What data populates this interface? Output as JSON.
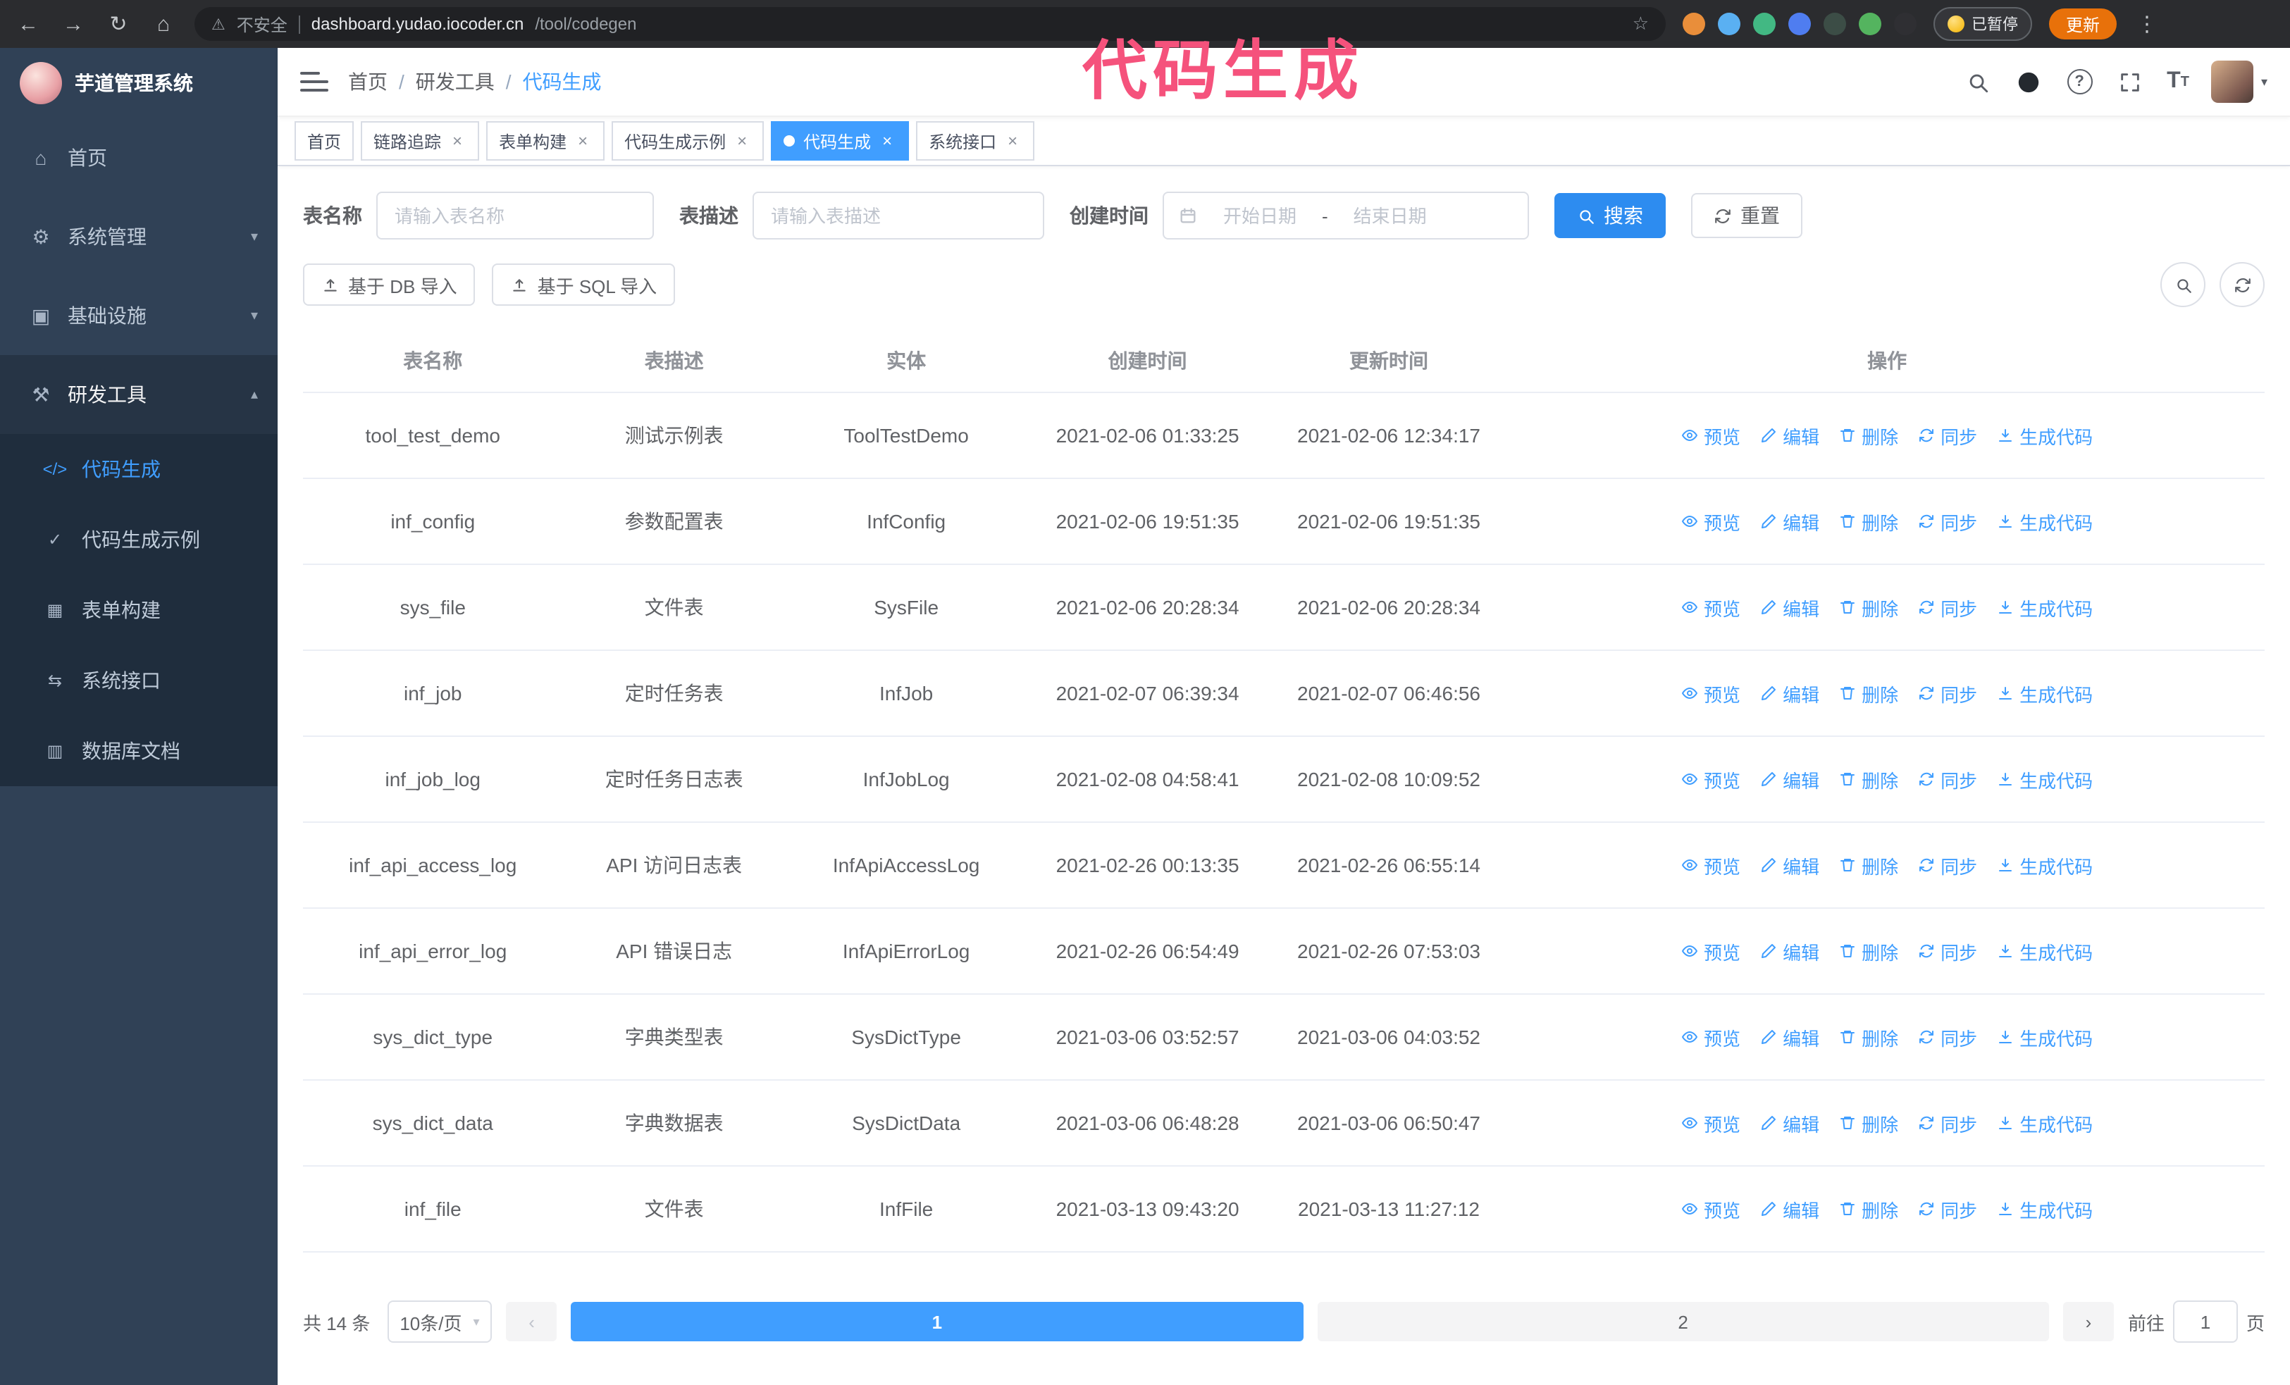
{
  "browser": {
    "security_text": "不安全",
    "url_host": "dashboard.yudao.iocoder.cn",
    "url_path": "/tool/codegen",
    "paused_badge": "已暂停",
    "update_button": "更新",
    "icons": {
      "back": "←",
      "forward": "→",
      "reload": "↻",
      "home": "⌂",
      "warning": "⚠",
      "star": "☆",
      "kebab": "⋮"
    }
  },
  "annotation": {
    "text": "代码生成",
    "color": "#f5527c"
  },
  "icons": {
    "caret_down": "▾",
    "caret_up": "▴",
    "close": "×",
    "help": "?",
    "font_big": "T",
    "font_small": "T"
  },
  "sidebar": {
    "logo_title": "芋道管理系统",
    "items": [
      {
        "label": "首页",
        "icon": "⌂"
      },
      {
        "label": "系统管理",
        "icon": "⚙"
      },
      {
        "label": "基础设施",
        "icon": "▣"
      },
      {
        "label": "研发工具",
        "icon": "⚒"
      }
    ],
    "sub_items": [
      {
        "label": "代码生成",
        "icon": "</>"
      },
      {
        "label": "代码生成示例",
        "icon": "✓"
      },
      {
        "label": "表单构建",
        "icon": "▦"
      },
      {
        "label": "系统接口",
        "icon": "⇆"
      },
      {
        "label": "数据库文档",
        "icon": "▥"
      }
    ]
  },
  "header": {
    "breadcrumb": [
      "首页",
      "研发工具",
      "代码生成"
    ],
    "separator": "/"
  },
  "tabs": [
    {
      "label": "首页"
    },
    {
      "label": "链路追踪"
    },
    {
      "label": "表单构建"
    },
    {
      "label": "代码生成示例"
    },
    {
      "label": "代码生成"
    },
    {
      "label": "系统接口"
    }
  ],
  "filters": {
    "table_name_label": "表名称",
    "table_name_placeholder": "请输入表名称",
    "table_desc_label": "表描述",
    "table_desc_placeholder": "请输入表描述",
    "create_time_label": "创建时间",
    "start_placeholder": "开始日期",
    "end_placeholder": "结束日期",
    "range_separator": "-",
    "search_button": "搜索",
    "reset_button": "重置"
  },
  "toolbar": {
    "import_db": "基于 DB 导入",
    "import_sql": "基于 SQL 导入"
  },
  "table": {
    "columns": [
      "表名称",
      "表描述",
      "实体",
      "创建时间",
      "更新时间",
      "操作"
    ],
    "actions": [
      {
        "label": "预览"
      },
      {
        "label": "编辑"
      },
      {
        "label": "删除"
      },
      {
        "label": "同步"
      },
      {
        "label": "生成代码"
      }
    ],
    "rows": [
      {
        "name": "tool_test_demo",
        "desc": "测试示例表",
        "entity": "ToolTestDemo",
        "created": "2021-02-06 01:33:25",
        "updated": "2021-02-06 12:34:17"
      },
      {
        "name": "inf_config",
        "desc": "参数配置表",
        "entity": "InfConfig",
        "created": "2021-02-06 19:51:35",
        "updated": "2021-02-06 19:51:35"
      },
      {
        "name": "sys_file",
        "desc": "文件表",
        "entity": "SysFile",
        "created": "2021-02-06 20:28:34",
        "updated": "2021-02-06 20:28:34"
      },
      {
        "name": "inf_job",
        "desc": "定时任务表",
        "entity": "InfJob",
        "created": "2021-02-07 06:39:34",
        "updated": "2021-02-07 06:46:56"
      },
      {
        "name": "inf_job_log",
        "desc": "定时任务日志表",
        "entity": "InfJobLog",
        "created": "2021-02-08 04:58:41",
        "updated": "2021-02-08 10:09:52"
      },
      {
        "name": "inf_api_access_log",
        "desc": "API 访问日志表",
        "entity": "InfApiAccessLog",
        "created": "2021-02-26 00:13:35",
        "updated": "2021-02-26 06:55:14"
      },
      {
        "name": "inf_api_error_log",
        "desc": "API 错误日志",
        "entity": "InfApiErrorLog",
        "created": "2021-02-26 06:54:49",
        "updated": "2021-02-26 07:53:03"
      },
      {
        "name": "sys_dict_type",
        "desc": "字典类型表",
        "entity": "SysDictType",
        "created": "2021-03-06 03:52:57",
        "updated": "2021-03-06 04:03:52"
      },
      {
        "name": "sys_dict_data",
        "desc": "字典数据表",
        "entity": "SysDictData",
        "created": "2021-03-06 06:48:28",
        "updated": "2021-03-06 06:50:47"
      },
      {
        "name": "inf_file",
        "desc": "文件表",
        "entity": "InfFile",
        "created": "2021-03-13 09:43:20",
        "updated": "2021-03-13 11:27:12"
      }
    ]
  },
  "pagination": {
    "total": "共 14 条",
    "page_size": "10条/页",
    "prev": "‹",
    "next": "›",
    "pages": [
      "1",
      "2"
    ],
    "goto_label": "前往",
    "goto_value": "1",
    "goto_suffix": "页"
  }
}
